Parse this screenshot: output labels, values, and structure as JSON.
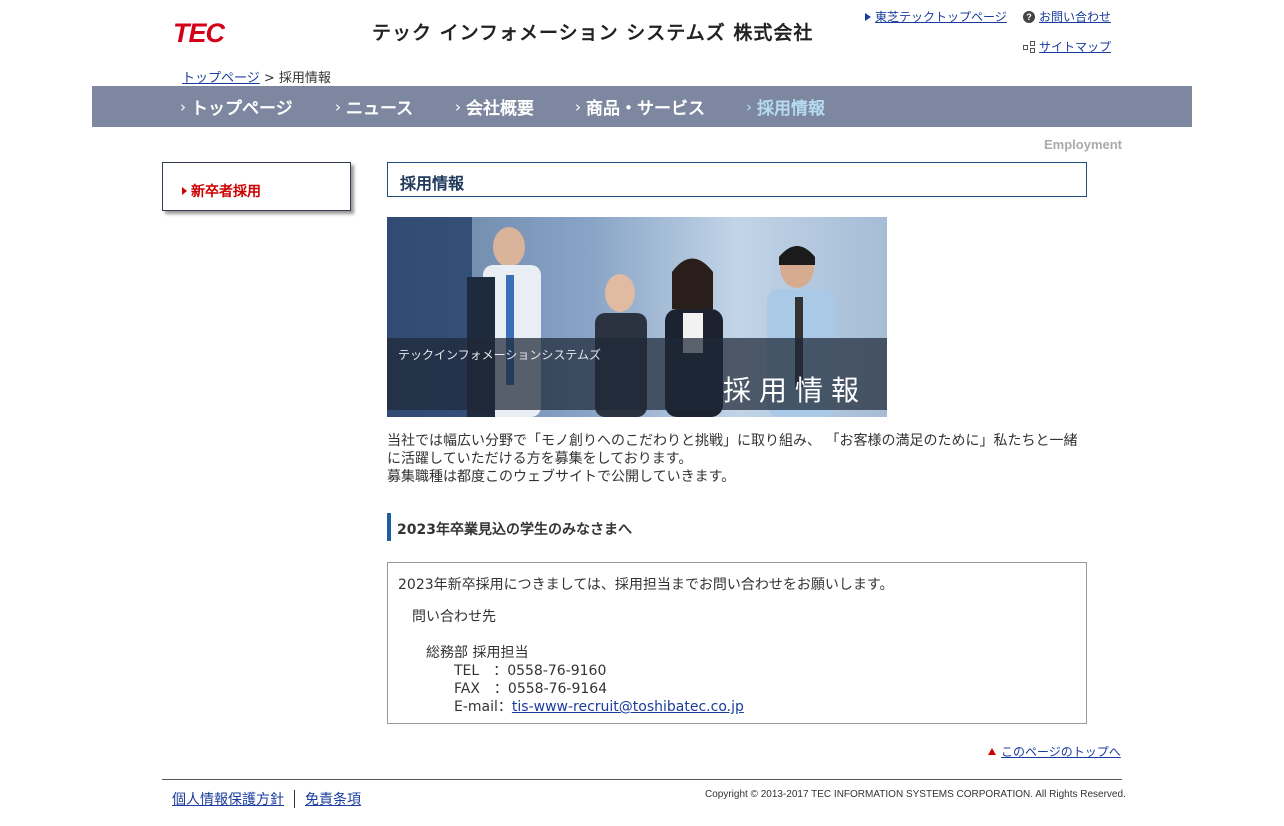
{
  "header": {
    "logo_text": "TEC",
    "company_name": "テック インフォメーション システムズ 株式会社",
    "links": {
      "toshiba_top": "東芝テックトップページ",
      "contact": "お問い合わせ",
      "sitemap": "サイトマップ"
    }
  },
  "breadcrumb": {
    "home": "トップページ",
    "separator": " > ",
    "current": "採用情報"
  },
  "nav": {
    "items": [
      {
        "label": "トップページ"
      },
      {
        "label": "ニュース"
      },
      {
        "label": "会社概要"
      },
      {
        "label": "商品・サービス"
      },
      {
        "label": "採用情報",
        "active": true
      }
    ],
    "chevron": "›"
  },
  "section_label": "Employment",
  "sidebar": {
    "items": [
      {
        "label": "新卒者採用"
      }
    ]
  },
  "main": {
    "heading": "採用情報",
    "hero": {
      "subtitle": "テックインフォメーションシステムズ",
      "title": "採用情報"
    },
    "intro": [
      "当社では幅広い分野で「モノ創りへのこだわりと挑戦」に取り組み、 「お客様の満足のために」私たちと一緒",
      "に活躍していただける方を募集をしております。",
      "募集職種は都度このウェブサイトで公開していきます。"
    ],
    "section_heading": "2023年卒業見込の学生のみなさまへ",
    "info": {
      "lead": "2023年新卒採用につきましては、採用担当までお問い合わせをお願いします。",
      "contact_title": "問い合わせ先",
      "dept": "総務部 採用担当",
      "tel": "TEL　：0558-76-9160",
      "fax": "FAX　：0558-76-9164",
      "email_label": "E-mail：",
      "email": "tis-www-recruit@toshibatec.co.jp"
    },
    "page_top": "このページのトップへ"
  },
  "footer": {
    "privacy": "個人情報保護方針",
    "disclaimer": "免責条項",
    "copyright": "Copyright © 2013-2017 TEC INFORMATION SYSTEMS CORPORATION. All Rights Reserved."
  },
  "colors": {
    "nav_bg": "#7d879f",
    "nav_active": "#b6dcf2",
    "brand_red": "#d4001a",
    "link_blue": "#1a3c9e",
    "heading_border": "#1f4f7a"
  }
}
